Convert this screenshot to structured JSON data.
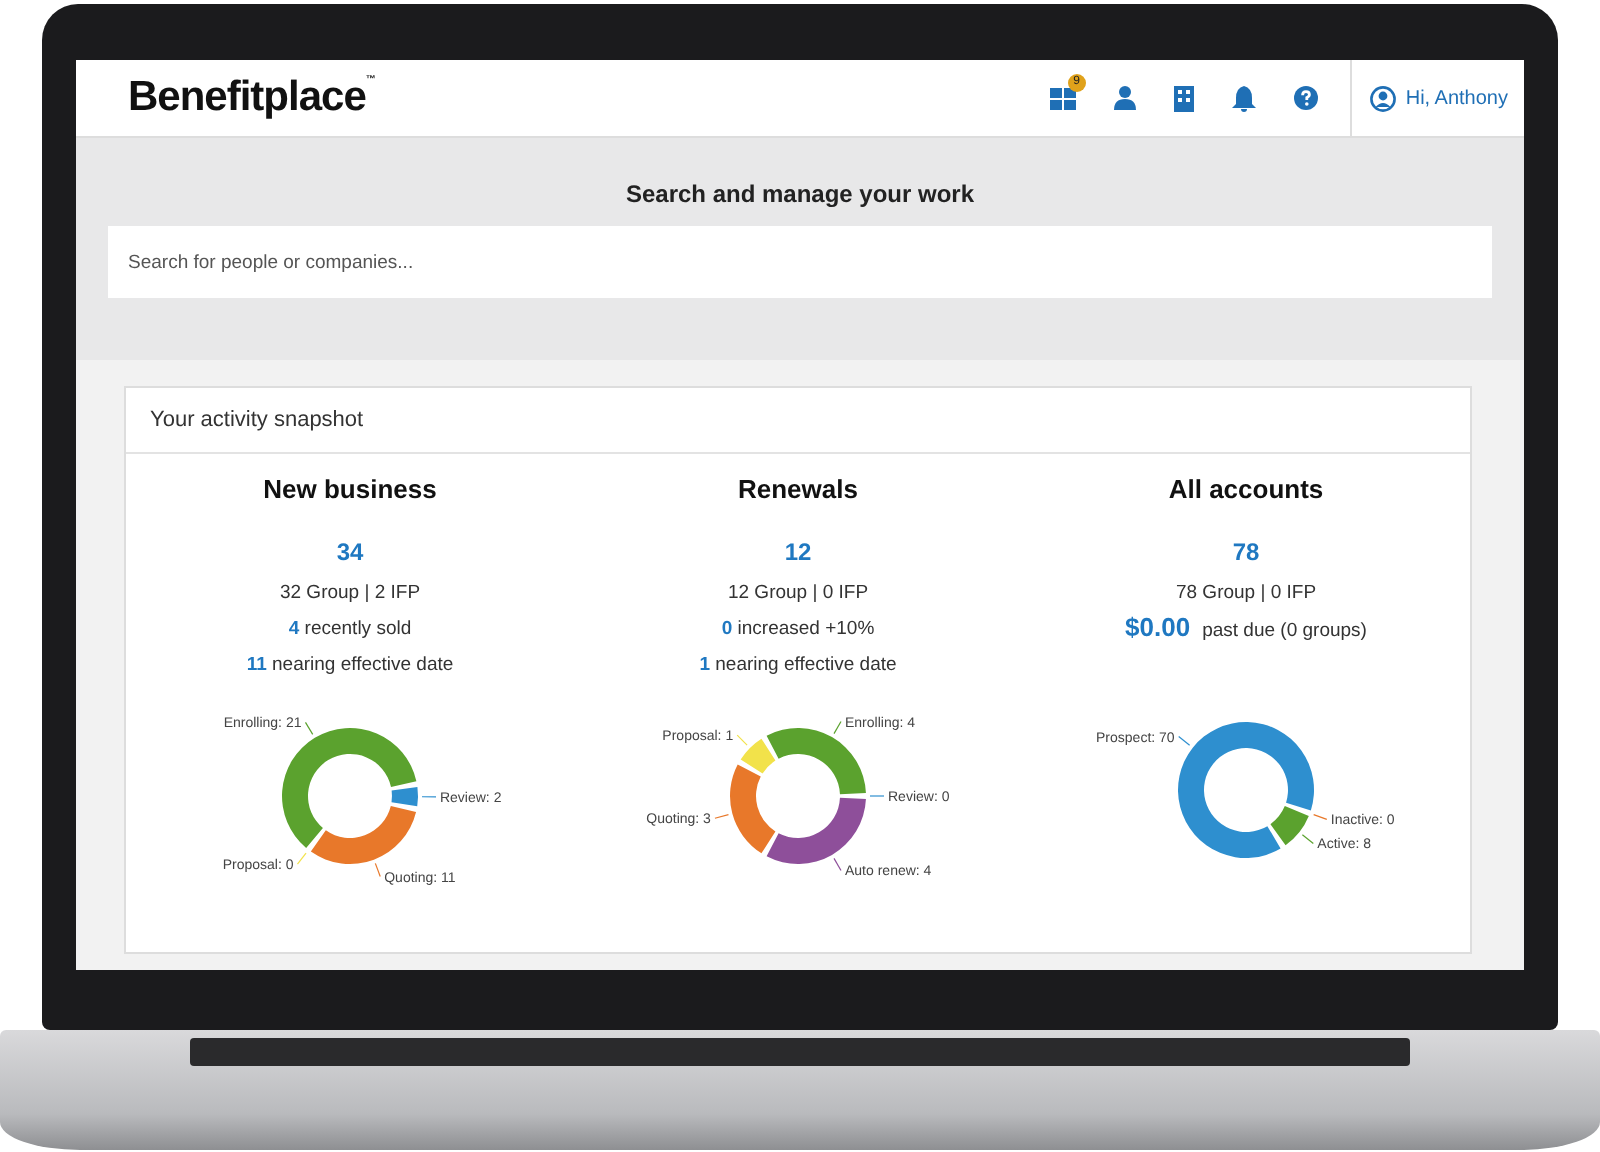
{
  "header": {
    "logo": "Benefitplace",
    "logo_mark": "™",
    "badge": "9",
    "user": "Hi, Anthony"
  },
  "search": {
    "title": "Search and manage your work",
    "placeholder": "Search for people or companies..."
  },
  "snapshot": {
    "title": "Your activity snapshot",
    "columns": [
      {
        "heading": "New business",
        "total": "34",
        "lines": [
          {
            "kind": "plain",
            "text": "32 Group | 2 IFP"
          },
          {
            "kind": "plain",
            "text": "**4** recently sold"
          },
          {
            "kind": "plain",
            "text": "**11** nearing effective date"
          }
        ],
        "chart_data": {
          "type": "donut",
          "categories": [
            "Review: 2",
            "Quoting: 11",
            "Proposal: 0",
            "Enrolling: 21"
          ],
          "values": [
            2,
            11,
            0,
            21
          ],
          "colors": [
            "#2e8fcf",
            "#e8782a",
            "#f2e24a",
            "#5ba22e"
          ]
        }
      },
      {
        "heading": "Renewals",
        "total": "12",
        "lines": [
          {
            "kind": "plain",
            "text": "12 Group | 0 IFP"
          },
          {
            "kind": "plain",
            "text": "**0** increased +10%"
          },
          {
            "kind": "plain",
            "text": "**1** nearing effective date"
          }
        ],
        "chart_data": {
          "type": "donut",
          "categories": [
            "Review: 0",
            "Auto renew: 4",
            "Quoting: 3",
            "Proposal: 1",
            "Enrolling: 4"
          ],
          "values": [
            0,
            4,
            3,
            1,
            4
          ],
          "colors": [
            "#2e8fcf",
            "#8e4f9a",
            "#e8782a",
            "#f2e24a",
            "#5ba22e"
          ]
        }
      },
      {
        "heading": "All accounts",
        "total": "78",
        "lines": [
          {
            "kind": "plain",
            "text": "78 Group | 0 IFP"
          },
          {
            "kind": "amount",
            "amount": "$0.00",
            "text": "past due (0 groups)"
          }
        ],
        "chart_data": {
          "type": "donut",
          "categories": [
            "Inactive: 0",
            "Active: 8",
            "Prospect: 70"
          ],
          "values": [
            0,
            8,
            70
          ],
          "colors": [
            "#e8782a",
            "#5ba22e",
            "#2e8fcf"
          ]
        }
      }
    ]
  }
}
